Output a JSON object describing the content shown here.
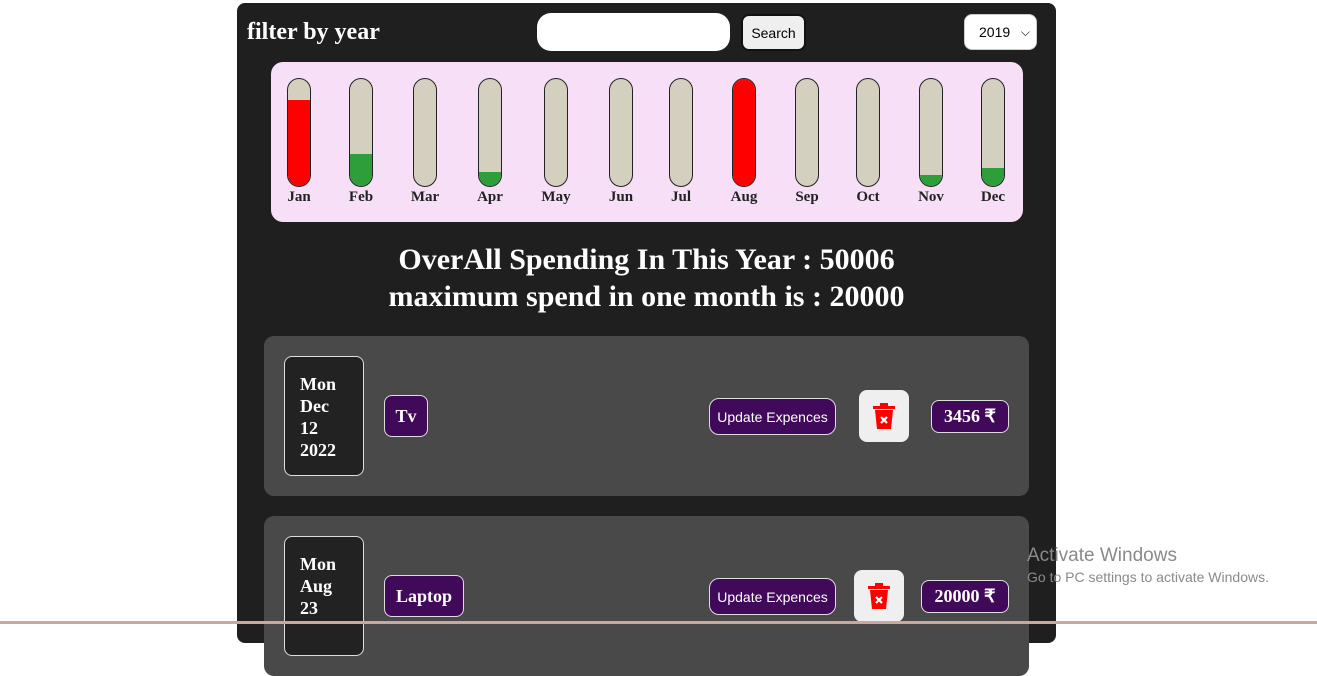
{
  "header": {
    "title": "filter by year",
    "search_placeholder": "",
    "search_button": "Search",
    "year_selected": "2019"
  },
  "chart_data": {
    "type": "bar",
    "categories": [
      "Jan",
      "Feb",
      "Mar",
      "Apr",
      "May",
      "Jun",
      "Jul",
      "Aug",
      "Sep",
      "Oct",
      "Nov",
      "Dec"
    ],
    "values": [
      0.8,
      0.3,
      0,
      0.13,
      0,
      0,
      0,
      1.0,
      0,
      0,
      0.1,
      0.17
    ],
    "value_unit": "fraction of bar filled",
    "colors": [
      "#ff0000",
      "#2e9e3a",
      "#2e9e3a",
      "#2e9e3a",
      "#2e9e3a",
      "#2e9e3a",
      "#2e9e3a",
      "#ff0000",
      "#2e9e3a",
      "#2e9e3a",
      "#2e9e3a",
      "#2e9e3a"
    ]
  },
  "summary": {
    "overall_line": "OverAll Spending In This Year : 50006",
    "max_line": "maximum spend in one month is : 20000"
  },
  "expenses": [
    {
      "date_day": "Mon",
      "date_month": "Dec",
      "date_num": "12",
      "date_year": "2022",
      "title": "Tv",
      "update_label": "Update Expences",
      "amount": "3456 ₹"
    },
    {
      "date_day": "Mon",
      "date_month": "Aug",
      "date_num": "23",
      "date_year": "",
      "title": "Laptop",
      "update_label": "Update Expences",
      "amount": "20000 ₹"
    }
  ],
  "watermark": {
    "line1": "Activate Windows",
    "line2": "Go to PC settings to activate Windows."
  },
  "icons": [
    "chevron-down-icon",
    "trash-icon"
  ],
  "colors": {
    "accent": "#40095a",
    "over": "#ff0000",
    "under": "#2e9e3a",
    "panel": "#f8dff8"
  }
}
